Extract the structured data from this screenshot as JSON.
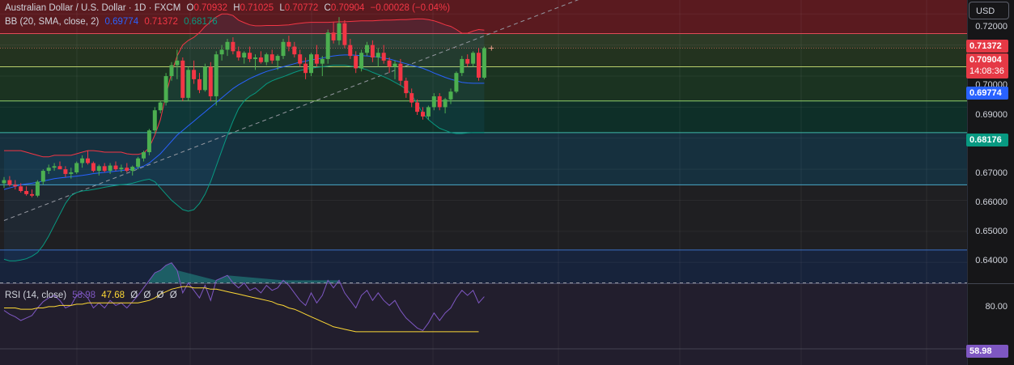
{
  "header": {
    "symbol": "Australian Dollar / U.S. Dollar · 1D · FXCM",
    "open_label": "O",
    "open": "0.70932",
    "high_label": "H",
    "high": "0.71025",
    "low_label": "L",
    "low": "0.70772",
    "close_label": "C",
    "close": "0.70904",
    "change": "−0.00028 (−0.04%)"
  },
  "bb": {
    "label": "BB (20, SMA, close, 2)",
    "basis": "0.69774",
    "upper": "0.71372",
    "lower": "0.68176"
  },
  "rsi": {
    "label": "RSI (14, close)",
    "value": "58.98",
    "ma": "47.68",
    "extra1": "Ø",
    "extra2": "Ø",
    "extra3": "Ø",
    "extra4": "Ø"
  },
  "currency_button": "USD",
  "price_axis": [
    "0.72000",
    "0.71000",
    "0.70000",
    "0.69000",
    "0.68000",
    "0.67000",
    "0.66000",
    "0.65000",
    "0.64000"
  ],
  "rsi_axis": [
    "80.00"
  ],
  "tags": {
    "upper": "0.71372",
    "last": "0.70904",
    "countdown": "14:08:36",
    "basis": "0.69774",
    "lower": "0.68176",
    "rsi": "58.98"
  },
  "colors": {
    "up": "#26a69a",
    "up_candle": "#4caf50",
    "down": "#f23645",
    "basis": "#2962ff",
    "upper": "#f23645",
    "lower": "#089981",
    "rsi": "#7e57c2",
    "rsi_ma": "#fdd835"
  },
  "chart_data": {
    "type": "candlestick",
    "ylim": [
      0.6333,
      0.7245
    ],
    "candles": [
      [
        0.6655,
        0.6675,
        0.664,
        0.6665
      ],
      [
        0.6665,
        0.6678,
        0.6645,
        0.665
      ],
      [
        0.665,
        0.6665,
        0.6635,
        0.6645
      ],
      [
        0.6645,
        0.6655,
        0.6625,
        0.663
      ],
      [
        0.663,
        0.6645,
        0.6615,
        0.662
      ],
      [
        0.662,
        0.6635,
        0.661,
        0.6615
      ],
      [
        0.6615,
        0.6665,
        0.661,
        0.666
      ],
      [
        0.666,
        0.67,
        0.665,
        0.6695
      ],
      [
        0.6695,
        0.6715,
        0.6685,
        0.6705
      ],
      [
        0.6705,
        0.672,
        0.6695,
        0.671
      ],
      [
        0.671,
        0.6725,
        0.67,
        0.67
      ],
      [
        0.67,
        0.671,
        0.6675,
        0.6685
      ],
      [
        0.6685,
        0.6705,
        0.667,
        0.669
      ],
      [
        0.669,
        0.6725,
        0.6685,
        0.672
      ],
      [
        0.672,
        0.6745,
        0.6705,
        0.6735
      ],
      [
        0.6735,
        0.676,
        0.6715,
        0.672
      ],
      [
        0.672,
        0.6725,
        0.669,
        0.6695
      ],
      [
        0.6695,
        0.6715,
        0.668,
        0.671
      ],
      [
        0.671,
        0.672,
        0.669,
        0.6695
      ],
      [
        0.6695,
        0.672,
        0.6685,
        0.6712
      ],
      [
        0.6712,
        0.6725,
        0.6695,
        0.67
      ],
      [
        0.67,
        0.6715,
        0.669,
        0.6705
      ],
      [
        0.6705,
        0.672,
        0.669,
        0.6695
      ],
      [
        0.6695,
        0.6712,
        0.668,
        0.6708
      ],
      [
        0.6708,
        0.674,
        0.67,
        0.6735
      ],
      [
        0.6735,
        0.676,
        0.6725,
        0.6755
      ],
      [
        0.6755,
        0.683,
        0.6745,
        0.6825
      ],
      [
        0.6825,
        0.69,
        0.6815,
        0.689
      ],
      [
        0.689,
        0.692,
        0.688,
        0.6915
      ],
      [
        0.6915,
        0.701,
        0.6905,
        0.7
      ],
      [
        0.7,
        0.7045,
        0.6985,
        0.7035
      ],
      [
        0.7035,
        0.7085,
        0.699,
        0.705
      ],
      [
        0.705,
        0.706,
        0.692,
        0.693
      ],
      [
        0.693,
        0.703,
        0.692,
        0.702
      ],
      [
        0.702,
        0.705,
        0.6975,
        0.699
      ],
      [
        0.699,
        0.701,
        0.6945,
        0.6955
      ],
      [
        0.6955,
        0.704,
        0.695,
        0.703
      ],
      [
        0.703,
        0.7045,
        0.692,
        0.6935
      ],
      [
        0.6935,
        0.708,
        0.6905,
        0.707
      ],
      [
        0.707,
        0.71,
        0.705,
        0.7085
      ],
      [
        0.7085,
        0.712,
        0.7065,
        0.711
      ],
      [
        0.711,
        0.7125,
        0.707,
        0.708
      ],
      [
        0.708,
        0.7095,
        0.705,
        0.706
      ],
      [
        0.706,
        0.708,
        0.704,
        0.7075
      ],
      [
        0.7075,
        0.7095,
        0.7045,
        0.7055
      ],
      [
        0.7055,
        0.707,
        0.702,
        0.706
      ],
      [
        0.706,
        0.708,
        0.704,
        0.7045
      ],
      [
        0.7045,
        0.7075,
        0.7035,
        0.707
      ],
      [
        0.707,
        0.7085,
        0.704,
        0.705
      ],
      [
        0.705,
        0.707,
        0.702,
        0.7065
      ],
      [
        0.7065,
        0.712,
        0.7055,
        0.711
      ],
      [
        0.711,
        0.713,
        0.708,
        0.7095
      ],
      [
        0.7095,
        0.711,
        0.706,
        0.707
      ],
      [
        0.707,
        0.7085,
        0.703,
        0.704
      ],
      [
        0.704,
        0.706,
        0.699,
        0.701
      ],
      [
        0.701,
        0.7075,
        0.7,
        0.707
      ],
      [
        0.707,
        0.71,
        0.703,
        0.704
      ],
      [
        0.704,
        0.7065,
        0.7,
        0.7055
      ],
      [
        0.7055,
        0.715,
        0.704,
        0.714
      ],
      [
        0.714,
        0.7175,
        0.7105,
        0.7115
      ],
      [
        0.7115,
        0.719,
        0.71,
        0.717
      ],
      [
        0.717,
        0.718,
        0.709,
        0.71
      ],
      [
        0.71,
        0.712,
        0.7055,
        0.7065
      ],
      [
        0.7065,
        0.708,
        0.701,
        0.7025
      ],
      [
        0.7025,
        0.7085,
        0.7015,
        0.7075
      ],
      [
        0.7075,
        0.711,
        0.7065,
        0.71
      ],
      [
        0.71,
        0.7115,
        0.7045,
        0.706
      ],
      [
        0.706,
        0.709,
        0.703,
        0.7075
      ],
      [
        0.7075,
        0.71,
        0.704,
        0.705
      ],
      [
        0.705,
        0.706,
        0.701,
        0.703
      ],
      [
        0.703,
        0.705,
        0.699,
        0.704
      ],
      [
        0.704,
        0.7055,
        0.697,
        0.6985
      ],
      [
        0.6985,
        0.6995,
        0.693,
        0.6945
      ],
      [
        0.6945,
        0.696,
        0.69,
        0.6915
      ],
      [
        0.6915,
        0.6925,
        0.6875,
        0.6885
      ],
      [
        0.6885,
        0.69,
        0.686,
        0.687
      ],
      [
        0.687,
        0.6905,
        0.686,
        0.69
      ],
      [
        0.69,
        0.6945,
        0.689,
        0.6935
      ],
      [
        0.6935,
        0.6945,
        0.689,
        0.69
      ],
      [
        0.69,
        0.693,
        0.688,
        0.6925
      ],
      [
        0.6925,
        0.696,
        0.691,
        0.695
      ],
      [
        0.695,
        0.7015,
        0.6945,
        0.701
      ],
      [
        0.701,
        0.7065,
        0.7,
        0.7055
      ],
      [
        0.7055,
        0.707,
        0.703,
        0.704
      ],
      [
        0.704,
        0.708,
        0.703,
        0.7075
      ],
      [
        0.7075,
        0.709,
        0.6985,
        0.6995
      ],
      [
        0.6995,
        0.7095,
        0.699,
        0.709
      ]
    ],
    "bb_upper": [
      0.676,
      0.676,
      0.676,
      0.676,
      0.6755,
      0.675,
      0.6745,
      0.674,
      0.674,
      0.6745,
      0.6745,
      0.6745,
      0.6745,
      0.675,
      0.6755,
      0.676,
      0.676,
      0.6758,
      0.6755,
      0.6755,
      0.6755,
      0.6755,
      0.675,
      0.6748,
      0.6748,
      0.6752,
      0.677,
      0.681,
      0.686,
      0.694,
      0.701,
      0.7065,
      0.71,
      0.7115,
      0.7125,
      0.714,
      0.716,
      0.7175,
      0.719,
      0.72,
      0.72,
      0.7195,
      0.718,
      0.7172,
      0.7165,
      0.7162,
      0.7162,
      0.7163,
      0.7163,
      0.7163,
      0.7164,
      0.7165,
      0.7168,
      0.717,
      0.7172,
      0.7173,
      0.7173,
      0.7173,
      0.7173,
      0.7174,
      0.7175,
      0.7175,
      0.7176,
      0.7177,
      0.7178,
      0.7178,
      0.7178,
      0.7179,
      0.718,
      0.718,
      0.7181,
      0.7182,
      0.7182,
      0.7183,
      0.7184,
      0.7184,
      0.7182,
      0.7178,
      0.7172,
      0.7165,
      0.716,
      0.715,
      0.7138,
      0.7138,
      0.7145,
      0.715,
      0.7148
    ],
    "bb_basis": [
      0.6635,
      0.664,
      0.6645,
      0.665,
      0.6653,
      0.6655,
      0.6658,
      0.6662,
      0.6666,
      0.667,
      0.6672,
      0.6674,
      0.6676,
      0.6678,
      0.668,
      0.6683,
      0.6686,
      0.6688,
      0.669,
      0.6692,
      0.6694,
      0.6696,
      0.6698,
      0.67,
      0.6705,
      0.671,
      0.672,
      0.6735,
      0.675,
      0.677,
      0.679,
      0.681,
      0.6825,
      0.684,
      0.6855,
      0.687,
      0.6885,
      0.69,
      0.6915,
      0.693,
      0.6945,
      0.696,
      0.6972,
      0.6982,
      0.6992,
      0.7,
      0.7008,
      0.7015,
      0.702,
      0.7025,
      0.703,
      0.7035,
      0.704,
      0.7045,
      0.7048,
      0.7052,
      0.7055,
      0.7058,
      0.7062,
      0.7065,
      0.7067,
      0.7068,
      0.7068,
      0.7067,
      0.7066,
      0.7065,
      0.7063,
      0.7061,
      0.7058,
      0.7055,
      0.705,
      0.7045,
      0.704,
      0.7035,
      0.703,
      0.7025,
      0.7018,
      0.701,
      0.7003,
      0.6996,
      0.699,
      0.6985,
      0.698,
      0.6978,
      0.6977,
      0.6977,
      0.6977
    ],
    "bb_lower": [
      0.641,
      0.6405,
      0.6405,
      0.6408,
      0.6412,
      0.642,
      0.6432,
      0.6455,
      0.6485,
      0.652,
      0.6555,
      0.659,
      0.6615,
      0.6625,
      0.663,
      0.6632,
      0.6635,
      0.6638,
      0.6642,
      0.6645,
      0.6648,
      0.665,
      0.6652,
      0.6655,
      0.666,
      0.6665,
      0.6668,
      0.666,
      0.664,
      0.662,
      0.66,
      0.6585,
      0.657,
      0.6565,
      0.657,
      0.659,
      0.662,
      0.666,
      0.671,
      0.676,
      0.681,
      0.6855,
      0.6895,
      0.692,
      0.6935,
      0.6945,
      0.696,
      0.6975,
      0.6985,
      0.6992,
      0.6998,
      0.7005,
      0.7012,
      0.7018,
      0.7022,
      0.7025,
      0.7028,
      0.703,
      0.7032,
      0.7035,
      0.7035,
      0.7035,
      0.7032,
      0.703,
      0.7025,
      0.702,
      0.7012,
      0.7005,
      0.6998,
      0.699,
      0.698,
      0.697,
      0.6958,
      0.694,
      0.691,
      0.688,
      0.686,
      0.6845,
      0.6832,
      0.6825,
      0.6818,
      0.6815,
      0.6815,
      0.6817,
      0.6818,
      0.6818,
      0.6818
    ],
    "rsi": [
      48,
      45,
      43,
      40,
      42,
      44,
      50,
      55,
      58,
      60,
      56,
      50,
      52,
      60,
      62,
      58,
      50,
      54,
      50,
      56,
      52,
      54,
      50,
      55,
      60,
      66,
      72,
      78,
      80,
      84,
      86,
      80,
      62,
      70,
      64,
      58,
      68,
      56,
      72,
      74,
      76,
      70,
      66,
      70,
      64,
      66,
      62,
      68,
      64,
      66,
      72,
      68,
      62,
      56,
      52,
      62,
      54,
      60,
      72,
      66,
      72,
      62,
      56,
      50,
      60,
      64,
      56,
      62,
      56,
      52,
      56,
      48,
      42,
      38,
      34,
      32,
      38,
      46,
      40,
      46,
      50,
      58,
      64,
      60,
      64,
      54,
      58.98
    ],
    "rsi_ma": [
      50,
      50,
      50,
      49,
      49,
      49,
      50,
      50,
      51,
      51,
      52,
      52,
      52,
      53,
      53,
      54,
      54,
      54,
      54,
      54,
      54,
      54,
      54,
      54,
      54,
      55,
      56,
      58,
      61,
      63,
      65,
      66,
      67,
      67,
      66,
      66,
      66,
      65,
      65,
      64,
      63,
      62,
      61,
      60,
      59,
      58,
      57,
      56,
      55,
      53,
      52,
      50,
      49,
      47,
      45,
      43,
      41,
      39,
      37,
      35,
      34,
      33,
      32,
      31,
      31,
      31,
      31,
      31,
      31,
      31,
      31,
      31,
      31,
      31,
      31,
      31,
      31,
      31,
      31,
      31,
      31,
      31,
      31,
      31,
      31,
      31,
      47.68
    ],
    "trend_line": {
      "x": [
        0,
        115
      ],
      "y": [
        0.6535,
        0.733
      ]
    },
    "zones": [
      {
        "from": 0.7137,
        "to": 0.7245,
        "color": "#5a1a1f"
      },
      {
        "from": 0.7137,
        "to": 0.709,
        "color": "#2d3a26"
      },
      {
        "from": 0.709,
        "to": 0.703,
        "color": "#23331f"
      },
      {
        "from": 0.703,
        "to": 0.692,
        "color": "#1b3321"
      },
      {
        "from": 0.692,
        "to": 0.6818,
        "color": "#0e2f28"
      },
      {
        "from": 0.6818,
        "to": 0.665,
        "color": "#16303e"
      },
      {
        "from": 0.665,
        "to": 0.644,
        "color": "#1f1f22"
      },
      {
        "from": 0.644,
        "to": 0.6333,
        "color": "#17233b"
      }
    ],
    "h_lines": [
      {
        "y": 0.7137,
        "color": "#e04a57"
      },
      {
        "y": 0.709,
        "color": "#9c5b49",
        "dashed": true
      },
      {
        "y": 0.703,
        "color": "#b9cf6b"
      },
      {
        "y": 0.692,
        "color": "#8fcf6b"
      },
      {
        "y": 0.6818,
        "color": "#3fb8a8"
      },
      {
        "y": 0.665,
        "color": "#4aa7c8"
      },
      {
        "y": 0.644,
        "color": "#3b6fc4"
      }
    ]
  }
}
